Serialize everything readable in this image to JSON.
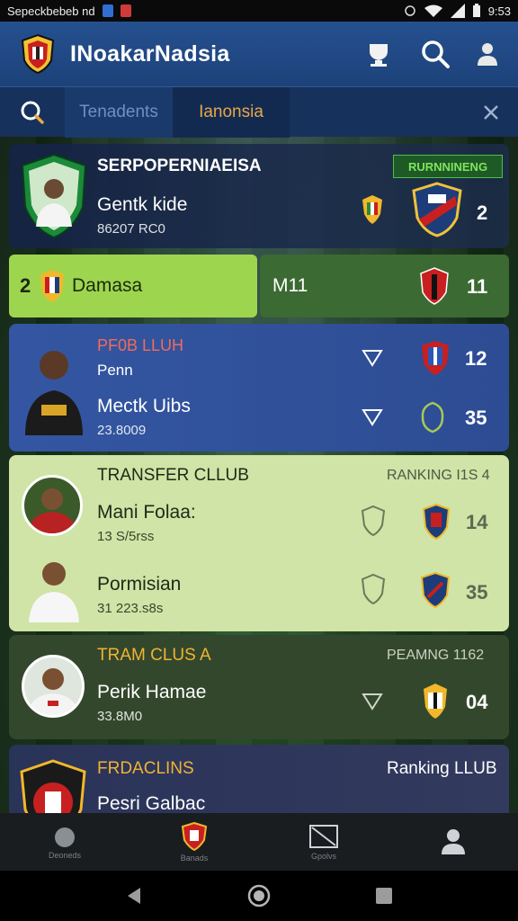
{
  "status_bar": {
    "left_text": "Sepeckbebeb  nd",
    "time": "9:53"
  },
  "app_bar": {
    "title": "INoakarNadsia"
  },
  "search_bar": {
    "tab_a": "Tenadents",
    "tab_b": "Ianonsia"
  },
  "card1": {
    "heading": "SERPOPERNIAEISA",
    "badge": "RURNNINENG",
    "name": "Gentk kide",
    "sub": "86207 RC0",
    "value": "2"
  },
  "card2": {
    "left_number": "2",
    "left_label": "Damasa",
    "right_label": "M11",
    "right_value": "11"
  },
  "card3": {
    "heading": "PF0B LLUH",
    "line2": "Penn",
    "name": "Mectk Uibs",
    "sub": "23.8009",
    "value_1": "12",
    "value_2": "35"
  },
  "card4": {
    "heading": "TRANSFER CLLUB",
    "ranking": "RANKING I1S 4",
    "row1_name": "Mani Folaa:",
    "row1_sub": "13 S/5rss",
    "row1_value": "14",
    "row2_name": "Pormisian",
    "row2_sub": "31 223.s8s",
    "row2_value": "35"
  },
  "card5": {
    "heading": "TRAM CLUS A",
    "ranking": "PEAMNG 1162",
    "name": "Perik Hamae",
    "sub": "33.8M0",
    "value": "04"
  },
  "card6": {
    "heading": "FRDACLINS",
    "ranking": "Ranking LLUB",
    "name": "Pesri Galbac"
  },
  "bottom_nav": [
    {
      "label": "Deoneds"
    },
    {
      "label": "Banads"
    },
    {
      "label": "Gpolvs"
    },
    {
      "label": ""
    }
  ],
  "colors": {
    "appbar": "#25508f",
    "accent_green": "#9ed54e",
    "accent_orange": "#e8a64a",
    "card_blue": "#3456a2",
    "card_lightgreen": "#cfe4a6"
  }
}
